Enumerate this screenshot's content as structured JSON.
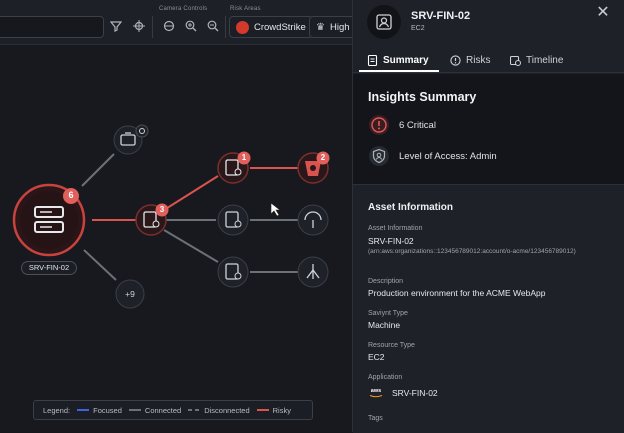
{
  "toolbar": {
    "camera_controls_label": "Camera Controls",
    "risk_areas_label": "Risk Areas",
    "risk_chip_label": "CrowdStrike",
    "high_chip_label": "High"
  },
  "graph": {
    "main_node_label": "SRV-FIN-02",
    "main_node_badge": "6",
    "mid_node_badge": "3",
    "node1_badge": "1",
    "node2_badge": "2",
    "more_label": "+9"
  },
  "legend": {
    "title": "Legend:",
    "items": [
      {
        "label": "Focused",
        "color": "#3e63dd"
      },
      {
        "label": "Connected",
        "color": "#6b7079"
      },
      {
        "label": "Disconnected",
        "color": "#6b7079"
      },
      {
        "label": "Risky",
        "color": "#d9534f"
      }
    ]
  },
  "panel": {
    "title": "SRV-FIN-02",
    "subtitle": "EC2",
    "tabs": [
      {
        "label": "Summary"
      },
      {
        "label": "Risks"
      },
      {
        "label": "Timeline"
      }
    ],
    "insights": {
      "title": "Insights Summary",
      "critical": "6 Critical",
      "access": "Level of Access: Admin"
    },
    "asset": {
      "title": "Asset Information",
      "fields": [
        {
          "label": "Asset Information",
          "value": "SRV-FIN-02",
          "sub": "(arn:aws:organizations::123456789012:account/o-acme/123456789012)"
        },
        {
          "label": "Description",
          "value": "Production environment for the ACME WebApp"
        },
        {
          "label": "Saviynt Type",
          "value": "Machine"
        },
        {
          "label": "Resource Type",
          "value": "EC2"
        },
        {
          "label": "Application",
          "value": "SRV-FIN-02",
          "logo": "aws"
        },
        {
          "label": "Tags"
        }
      ]
    }
  },
  "colors": {
    "risky": "#d9534f",
    "connected": "#6b7079",
    "critical": "#e05a5a",
    "accent": "#ffffff"
  }
}
